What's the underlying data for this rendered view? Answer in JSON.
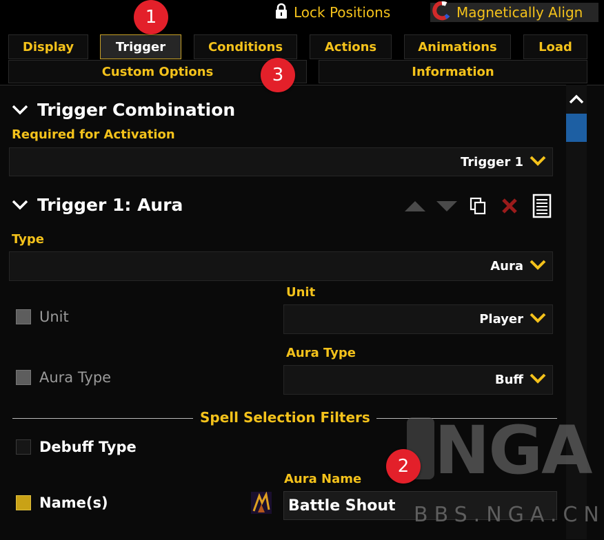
{
  "topbar": {
    "lock_label": "Lock Positions",
    "magnet_label": "Magnetically Align"
  },
  "tabs": [
    "Display",
    "Trigger",
    "Conditions",
    "Actions",
    "Animations",
    "Load"
  ],
  "tabs_row2": [
    "Custom Options",
    "Information"
  ],
  "active_tab": "Trigger",
  "badges": [
    "1",
    "2",
    "3"
  ],
  "combination": {
    "title": "Trigger Combination",
    "required_label": "Required for Activation",
    "required_value": "Trigger 1"
  },
  "trigger": {
    "title": "Trigger 1: Aura",
    "type_label": "Type",
    "type_value": "Aura",
    "unit_check_label": "Unit",
    "unit_label": "Unit",
    "unit_value": "Player",
    "auratype_check_label": "Aura Type",
    "auratype_label": "Aura Type",
    "auratype_value": "Buff",
    "filters_heading": "Spell Selection Filters",
    "debuff_label": "Debuff Type",
    "names_label": "Name(s)",
    "aura_name_label": "Aura Name",
    "aura_name_value": "Battle Shout"
  },
  "watermark": {
    "logo_text": "NGA",
    "site_text": "BBS.NGA.CN"
  },
  "colors": {
    "accent_gold": "#f4c21b",
    "badge_red": "#e3202a",
    "scroll_blue": "#1d5fa3",
    "delete_red": "#9b1b1b"
  }
}
